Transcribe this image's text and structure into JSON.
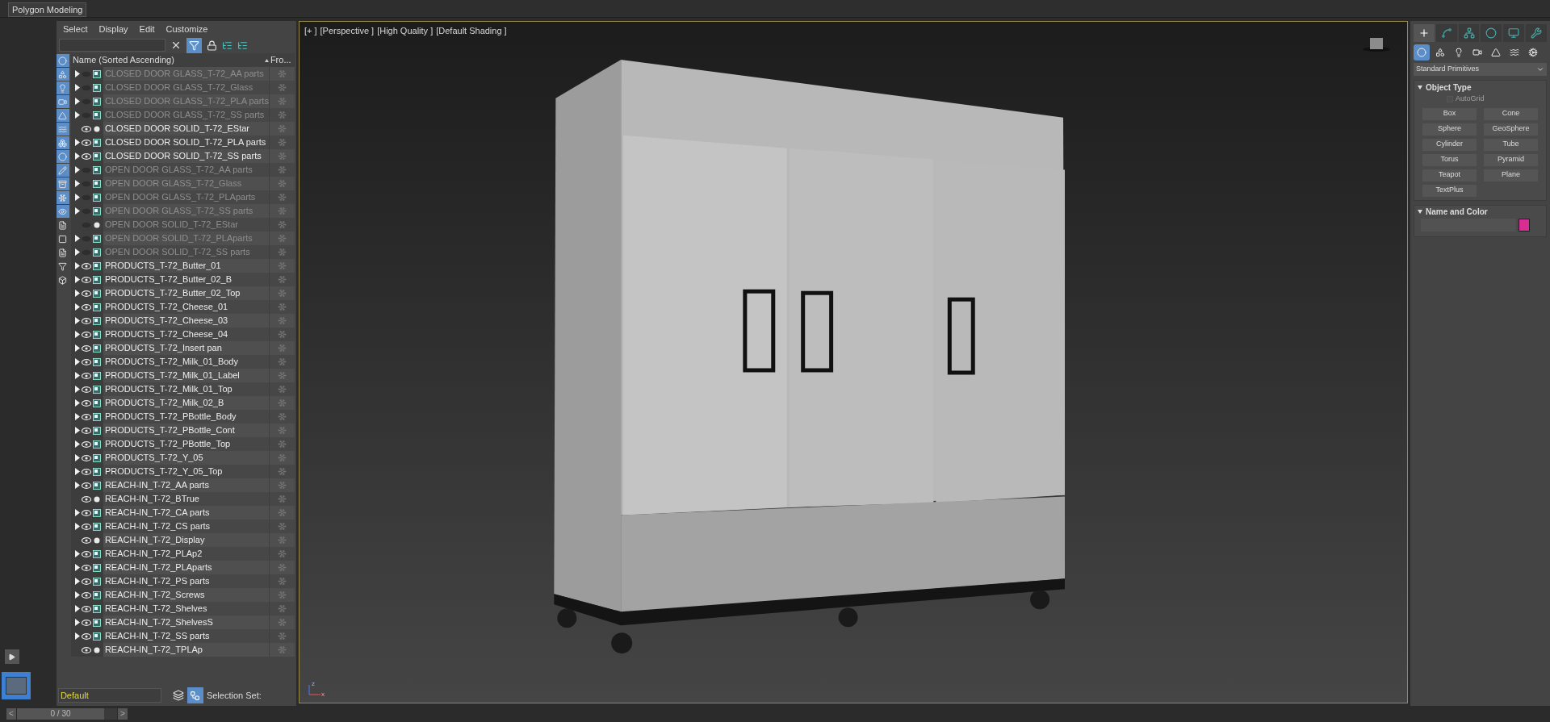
{
  "ribbon": {
    "tab": "Polygon Modeling"
  },
  "scene_explorer": {
    "menu": [
      "Select",
      "Display",
      "Edit",
      "Customize"
    ],
    "filter_toggle": {
      "selected": true
    },
    "filters": [
      {
        "on": true
      },
      {
        "on": true
      },
      {
        "on": true
      },
      {
        "on": true
      },
      {
        "on": true
      },
      {
        "on": true
      },
      {
        "on": true
      },
      {
        "on": true
      },
      {
        "on": true
      },
      {
        "on": true
      },
      {
        "on": true
      },
      {
        "on": true
      },
      {
        "on": false
      },
      {
        "on": false
      },
      {
        "on": false
      },
      {
        "on": false
      },
      {
        "on": false
      }
    ],
    "columns": [
      "Name (Sorted Ascending)",
      "Fro..."
    ],
    "rows": [
      {
        "name": "CLOSED DOOR GLASS_T-72_AA parts",
        "kind": "group",
        "visible": false
      },
      {
        "name": "CLOSED DOOR GLASS_T-72_Glass",
        "kind": "group",
        "visible": false
      },
      {
        "name": "CLOSED DOOR GLASS_T-72_PLA parts",
        "kind": "group",
        "visible": false
      },
      {
        "name": "CLOSED DOOR GLASS_T-72_SS parts",
        "kind": "group",
        "visible": false
      },
      {
        "name": "CLOSED DOOR SOLID_T-72_EStar",
        "kind": "object",
        "visible": true
      },
      {
        "name": "CLOSED DOOR SOLID_T-72_PLA parts",
        "kind": "group",
        "visible": true
      },
      {
        "name": "CLOSED DOOR SOLID_T-72_SS parts",
        "kind": "group",
        "visible": true
      },
      {
        "name": "OPEN DOOR GLASS_T-72_AA parts",
        "kind": "group",
        "visible": false
      },
      {
        "name": "OPEN DOOR GLASS_T-72_Glass",
        "kind": "group",
        "visible": false
      },
      {
        "name": "OPEN DOOR GLASS_T-72_PLAparts",
        "kind": "group",
        "visible": false
      },
      {
        "name": "OPEN DOOR GLASS_T-72_SS parts",
        "kind": "group",
        "visible": false
      },
      {
        "name": "OPEN DOOR SOLID_T-72_EStar",
        "kind": "object",
        "visible": false
      },
      {
        "name": "OPEN DOOR SOLID_T-72_PLAparts",
        "kind": "group",
        "visible": false
      },
      {
        "name": "OPEN DOOR SOLID_T-72_SS parts",
        "kind": "group",
        "visible": false
      },
      {
        "name": "PRODUCTS_T-72_Butter_01",
        "kind": "group",
        "visible": true
      },
      {
        "name": "PRODUCTS_T-72_Butter_02_B",
        "kind": "group",
        "visible": true
      },
      {
        "name": "PRODUCTS_T-72_Butter_02_Top",
        "kind": "group",
        "visible": true
      },
      {
        "name": "PRODUCTS_T-72_Cheese_01",
        "kind": "group",
        "visible": true
      },
      {
        "name": "PRODUCTS_T-72_Cheese_03",
        "kind": "group",
        "visible": true
      },
      {
        "name": "PRODUCTS_T-72_Cheese_04",
        "kind": "group",
        "visible": true
      },
      {
        "name": "PRODUCTS_T-72_Insert pan",
        "kind": "group",
        "visible": true
      },
      {
        "name": "PRODUCTS_T-72_Milk_01_Body",
        "kind": "group",
        "visible": true
      },
      {
        "name": "PRODUCTS_T-72_Milk_01_Label",
        "kind": "group",
        "visible": true
      },
      {
        "name": "PRODUCTS_T-72_Milk_01_Top",
        "kind": "group",
        "visible": true
      },
      {
        "name": "PRODUCTS_T-72_Milk_02_B",
        "kind": "group",
        "visible": true
      },
      {
        "name": "PRODUCTS_T-72_PBottle_Body",
        "kind": "group",
        "visible": true
      },
      {
        "name": "PRODUCTS_T-72_PBottle_Cont",
        "kind": "group",
        "visible": true
      },
      {
        "name": "PRODUCTS_T-72_PBottle_Top",
        "kind": "group",
        "visible": true
      },
      {
        "name": "PRODUCTS_T-72_Y_05",
        "kind": "group",
        "visible": true
      },
      {
        "name": "PRODUCTS_T-72_Y_05_Top",
        "kind": "group",
        "visible": true
      },
      {
        "name": "REACH-IN_T-72_AA parts",
        "kind": "group",
        "visible": true
      },
      {
        "name": "REACH-IN_T-72_BTrue",
        "kind": "object",
        "visible": true
      },
      {
        "name": "REACH-IN_T-72_CA parts",
        "kind": "group",
        "visible": true
      },
      {
        "name": "REACH-IN_T-72_CS parts",
        "kind": "group",
        "visible": true
      },
      {
        "name": "REACH-IN_T-72_Display",
        "kind": "object",
        "visible": true
      },
      {
        "name": "REACH-IN_T-72_PLAp2",
        "kind": "group",
        "visible": true
      },
      {
        "name": "REACH-IN_T-72_PLAparts",
        "kind": "group",
        "visible": true
      },
      {
        "name": "REACH-IN_T-72_PS parts",
        "kind": "group",
        "visible": true
      },
      {
        "name": "REACH-IN_T-72_Screws",
        "kind": "group",
        "visible": true
      },
      {
        "name": "REACH-IN_T-72_Shelves",
        "kind": "group",
        "visible": true
      },
      {
        "name": "REACH-IN_T-72_ShelvesS",
        "kind": "group",
        "visible": true
      },
      {
        "name": "REACH-IN_T-72_SS parts",
        "kind": "group",
        "visible": true
      },
      {
        "name": "REACH-IN_T-72_TPLAp",
        "kind": "object",
        "visible": true
      }
    ],
    "layer": "Default",
    "selection_set_label": "Selection Set:"
  },
  "viewport": {
    "labels": [
      "[+ ]",
      "[Perspective ]",
      "[High Quality ]",
      "[Default Shading ]"
    ],
    "axis_labels": [
      "z",
      "x"
    ]
  },
  "command_panel": {
    "tabs": [
      {
        "selected": true
      },
      {
        "selected": false
      },
      {
        "selected": false
      },
      {
        "selected": false
      },
      {
        "selected": false
      },
      {
        "selected": false
      }
    ],
    "subtabs": [
      {
        "selected": true
      },
      {
        "selected": false
      },
      {
        "selected": false
      },
      {
        "selected": false
      },
      {
        "selected": false
      },
      {
        "selected": false
      },
      {
        "selected": false
      }
    ],
    "category": "Standard Primitives",
    "object_type": {
      "title": "Object Type",
      "autogrid": {
        "label": "AutoGrid",
        "checked": false,
        "disabled": true
      },
      "buttons": [
        "Box",
        "Cone",
        "Sphere",
        "GeoSphere",
        "Cylinder",
        "Tube",
        "Torus",
        "Pyramid",
        "Teapot",
        "Plane",
        "TextPlus"
      ]
    },
    "name_and_color": {
      "title": "Name and Color",
      "color": "#d62e94"
    }
  },
  "time_slider": {
    "label": "0 / 30",
    "level": 0,
    "prev": "<",
    "next": ">"
  }
}
